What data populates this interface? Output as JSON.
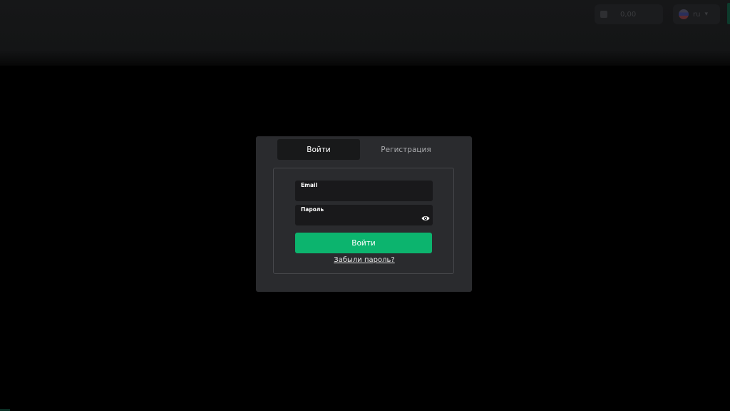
{
  "header": {
    "balance_text": "0,00",
    "language_code": "ru"
  },
  "auth_modal": {
    "tabs": [
      {
        "label": "Войти",
        "active": true
      },
      {
        "label": "Регистрация",
        "active": false
      }
    ],
    "email_field": {
      "label": "Email",
      "value": ""
    },
    "password_field": {
      "label": "Пароль",
      "value": "",
      "toggle_icon": "eye-icon"
    },
    "submit_label": "Войти",
    "forgot_link": "Забыли пароль?"
  },
  "colors": {
    "background": "#000000",
    "modal_bg": "#2a2b2e",
    "input_bg": "#19191b",
    "accent_green": "#0cb46e",
    "tab_active_bg": "#18191a"
  }
}
